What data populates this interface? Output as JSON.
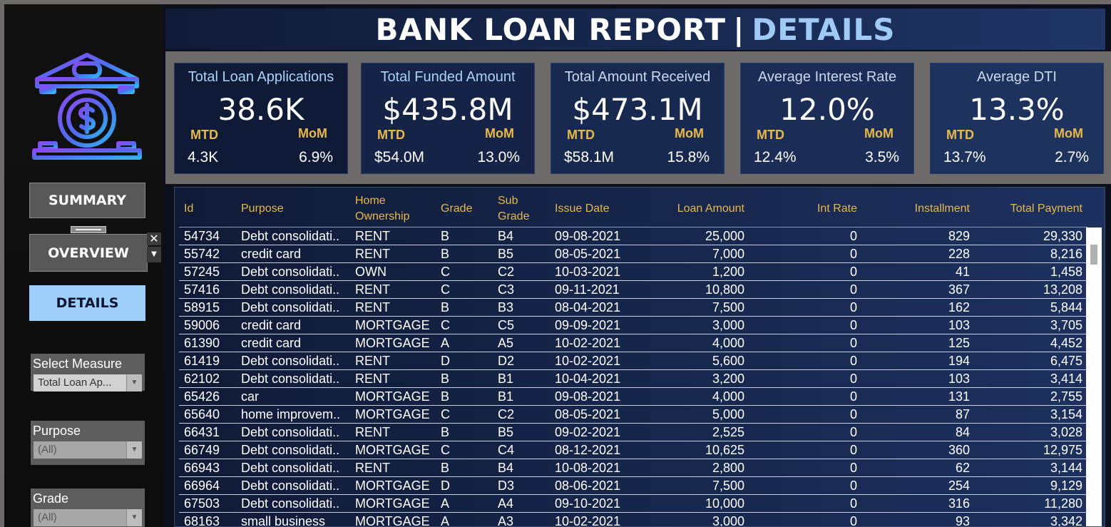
{
  "title": {
    "main": "BANK LOAN REPORT",
    "separator": "|",
    "highlight": "DETAILS"
  },
  "nav": {
    "summary": "SUMMARY",
    "overview": "OVERVIEW",
    "details": "DETAILS",
    "close_glyph": "✕",
    "drop_glyph": "▼"
  },
  "filters": {
    "measure": {
      "label": "Select Measure",
      "value": "Total Loan Ap..."
    },
    "purpose": {
      "label": "Purpose",
      "value": "(All)"
    },
    "grade": {
      "label": "Grade",
      "value": "(All)"
    },
    "arrow_glyph": "▼"
  },
  "kpis": [
    {
      "title": "Total Loan Applications",
      "value": "38.6K",
      "mtd_label": "MTD",
      "mom_label": "MoM",
      "mtd": "4.3K",
      "mom": "6.9%"
    },
    {
      "title": "Total Funded Amount",
      "value": "$435.8M",
      "mtd_label": "MTD",
      "mom_label": "MoM",
      "mtd": "$54.0M",
      "mom": "13.0%"
    },
    {
      "title": "Total Amount Received",
      "value": "$473.1M",
      "mtd_label": "MTD",
      "mom_label": "MoM",
      "mtd": "$58.1M",
      "mom": "15.8%"
    },
    {
      "title": "Average Interest Rate",
      "value": "12.0%",
      "mtd_label": "MTD",
      "mom_label": "MoM",
      "mtd": "12.4%",
      "mom": "3.5%"
    },
    {
      "title": "Average DTI",
      "value": "13.3%",
      "mtd_label": "MTD",
      "mom_label": "MoM",
      "mtd": "13.7%",
      "mom": "2.7%"
    }
  ],
  "table": {
    "headers": {
      "id": "Id",
      "purpose": "Purpose",
      "home1": "Home",
      "home2": "Ownership",
      "grade": "Grade",
      "sub1": "Sub",
      "sub2": "Grade",
      "issue": "Issue Date",
      "amt": "Loan Amount",
      "int": "Int Rate",
      "inst": "Installment",
      "pay": "Total Payment"
    },
    "rows": [
      [
        "54734",
        "Debt consolidati..",
        "RENT",
        "B",
        "B4",
        "09-08-2021",
        "25,000",
        "0",
        "829",
        "29,330"
      ],
      [
        "55742",
        "credit card",
        "RENT",
        "B",
        "B5",
        "08-05-2021",
        "7,000",
        "0",
        "228",
        "8,216"
      ],
      [
        "57245",
        "Debt consolidati..",
        "OWN",
        "C",
        "C2",
        "10-03-2021",
        "1,200",
        "0",
        "41",
        "1,458"
      ],
      [
        "57416",
        "Debt consolidati..",
        "RENT",
        "C",
        "C3",
        "09-11-2021",
        "10,800",
        "0",
        "367",
        "13,208"
      ],
      [
        "58915",
        "Debt consolidati..",
        "RENT",
        "B",
        "B3",
        "08-04-2021",
        "7,500",
        "0",
        "162",
        "5,844"
      ],
      [
        "59006",
        "credit card",
        "MORTGAGE",
        "C",
        "C5",
        "09-09-2021",
        "3,000",
        "0",
        "103",
        "3,705"
      ],
      [
        "61390",
        "credit card",
        "MORTGAGE",
        "A",
        "A5",
        "10-02-2021",
        "4,000",
        "0",
        "125",
        "4,452"
      ],
      [
        "61419",
        "Debt consolidati..",
        "RENT",
        "D",
        "D2",
        "10-02-2021",
        "5,600",
        "0",
        "194",
        "6,475"
      ],
      [
        "62102",
        "Debt consolidati..",
        "RENT",
        "B",
        "B1",
        "10-04-2021",
        "3,200",
        "0",
        "103",
        "3,414"
      ],
      [
        "65426",
        "car",
        "MORTGAGE",
        "B",
        "B1",
        "09-08-2021",
        "4,000",
        "0",
        "131",
        "2,755"
      ],
      [
        "65640",
        "home improvem..",
        "MORTGAGE",
        "C",
        "C2",
        "08-05-2021",
        "5,000",
        "0",
        "87",
        "3,154"
      ],
      [
        "66431",
        "Debt consolidati..",
        "RENT",
        "B",
        "B5",
        "09-02-2021",
        "2,525",
        "0",
        "84",
        "3,028"
      ],
      [
        "66749",
        "Debt consolidati..",
        "MORTGAGE",
        "C",
        "C4",
        "08-12-2021",
        "10,625",
        "0",
        "360",
        "12,975"
      ],
      [
        "66943",
        "Debt consolidati..",
        "RENT",
        "B",
        "B4",
        "10-08-2021",
        "2,800",
        "0",
        "62",
        "3,144"
      ],
      [
        "66964",
        "Debt consolidati..",
        "MORTGAGE",
        "D",
        "D3",
        "08-06-2021",
        "7,500",
        "0",
        "254",
        "9,129"
      ],
      [
        "67503",
        "Debt consolidati..",
        "MORTGAGE",
        "A",
        "A4",
        "09-10-2021",
        "10,000",
        "0",
        "316",
        "11,280"
      ],
      [
        "68163",
        "small business",
        "MORTGAGE",
        "A",
        "A3",
        "10-02-2021",
        "3,000",
        "0",
        "93",
        "3,342"
      ]
    ]
  }
}
